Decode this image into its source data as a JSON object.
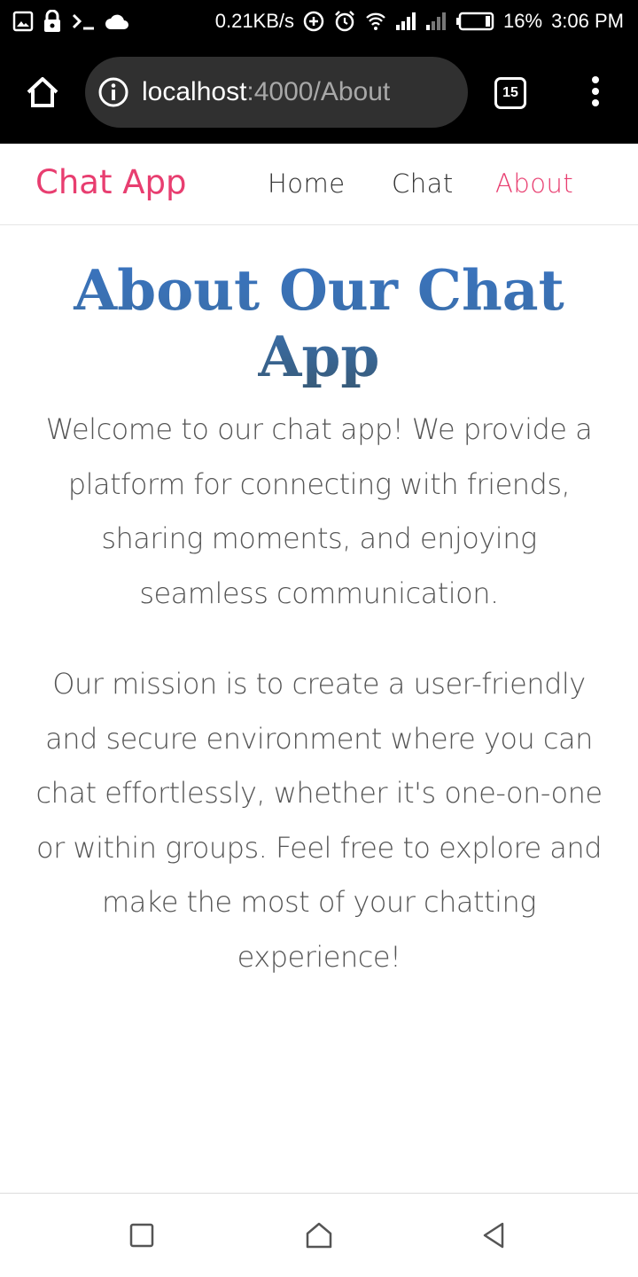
{
  "status_bar": {
    "network_speed": "0.21KB/s",
    "battery_percent": "16%",
    "time": "3:06 PM",
    "left_icons": [
      "image-icon",
      "lock-icon",
      "terminal-icon",
      "cloud-icon"
    ],
    "right_icons": [
      "data-saver-icon",
      "alarm-icon",
      "wifi-icon",
      "signal-icon",
      "signal-weak-icon",
      "battery-icon"
    ]
  },
  "browser": {
    "url_host": "localhost",
    "url_path": ":4000/About",
    "tab_count": "15"
  },
  "site_nav": {
    "brand": "Chat App",
    "links": [
      {
        "label": "Home",
        "active": false
      },
      {
        "label": "Chat",
        "active": false
      },
      {
        "label": "About",
        "active": true
      }
    ]
  },
  "main": {
    "title": "About Our Chat App",
    "paragraphs": [
      "Welcome to our chat app! We provide a platform for connecting with friends, sharing moments, and enjoying seamless communication.",
      "Our mission is to create a user-friendly and secure environment where you can chat effortlessly, whether it's one-on-one or within groups. Feel free to explore and make the most of your chatting experience!"
    ]
  },
  "colors": {
    "brand_accent": "#e83e70",
    "title_blue": "#3a74c0",
    "body_text": "#555555",
    "nav_text": "#333333"
  }
}
